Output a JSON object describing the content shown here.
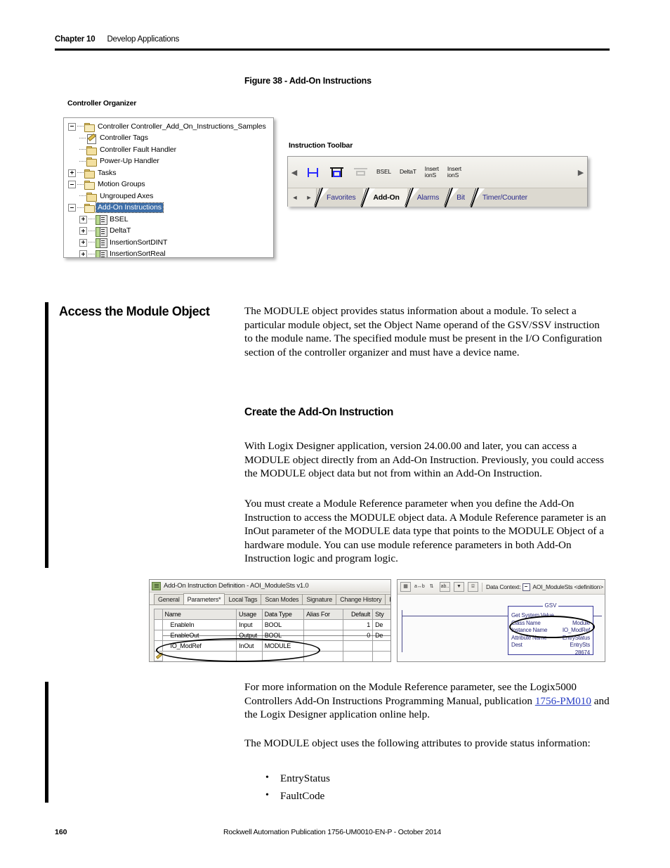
{
  "header": {
    "chapter": "Chapter 10",
    "title": "Develop Applications"
  },
  "figure": {
    "caption": "Figure 38 - Add-On Instructions",
    "organizer_label": "Controller Organizer",
    "toolbar_label": "Instruction Toolbar"
  },
  "controller_organizer": {
    "nodes": [
      {
        "label": "Controller Controller_Add_On_Instructions_Samples",
        "depth": 0,
        "icon": "folder-open-icon",
        "expander": "minus",
        "selected": false
      },
      {
        "label": "Controller Tags",
        "depth": 1,
        "icon": "tags-icon",
        "expander": "none",
        "selected": false
      },
      {
        "label": "Controller Fault Handler",
        "depth": 1,
        "icon": "folder-icon",
        "expander": "none",
        "selected": false
      },
      {
        "label": "Power-Up Handler",
        "depth": 1,
        "icon": "folder-icon",
        "expander": "none",
        "selected": false
      },
      {
        "label": "Tasks",
        "depth": 0,
        "icon": "folder-icon",
        "expander": "plus",
        "selected": false
      },
      {
        "label": "Motion Groups",
        "depth": 0,
        "icon": "folder-open-icon",
        "expander": "minus",
        "selected": false
      },
      {
        "label": "Ungrouped Axes",
        "depth": 1,
        "icon": "folder-icon",
        "expander": "none",
        "selected": false
      },
      {
        "label": "Add-On Instructions",
        "depth": 0,
        "icon": "folder-open-icon",
        "expander": "minus",
        "selected": true
      },
      {
        "label": "BSEL",
        "depth": 1,
        "icon": "aoi-icon",
        "expander": "plus",
        "selected": false
      },
      {
        "label": "DeltaT",
        "depth": 1,
        "icon": "aoi-icon",
        "expander": "plus",
        "selected": false
      },
      {
        "label": "InsertionSortDINT",
        "depth": 1,
        "icon": "aoi-icon",
        "expander": "plus",
        "selected": false
      },
      {
        "label": "InsertionSortReal",
        "depth": 1,
        "icon": "aoi-icon",
        "expander": "plus",
        "selected": false
      }
    ]
  },
  "instruction_toolbar": {
    "scroll_left": "◀",
    "scroll_right": "▶",
    "instruction_labels": [
      "BSEL",
      "DeltaT",
      "Insert\nionS",
      "Insert\nionS"
    ],
    "tab_prev": "◄",
    "tab_next": "►",
    "tabs": [
      {
        "label": "Favorites",
        "active": false
      },
      {
        "label": "Add-On",
        "active": true
      },
      {
        "label": "Alarms",
        "active": false
      },
      {
        "label": "Bit",
        "active": false
      },
      {
        "label": "Timer/Counter",
        "active": false
      }
    ]
  },
  "sections": {
    "module_object_heading": "Access the Module Object",
    "module_object_body": "The MODULE object provides status information about a module. To select a particular module object, set the Object Name operand of the GSV/SSV instruction to the module name. The specified module must be present in the I/O Configuration section of the controller organizer and must have a device name.",
    "create_heading": "Create the Add-On Instruction",
    "create_body_1": "With Logix Designer application, version 24.00.00 and later, you can access a MODULE object directly from an Add-On Instruction. Previously, you could access the MODULE object data but not from within an Add-On Instruction.",
    "create_body_2": "You must create a Module Reference parameter when you define the Add-On Instruction to access the MODULE object data. A Module Reference parameter is an InOut parameter of the MODULE data type that points to the MODULE Object of a hardware module. You can use module reference parameters in both Add-On Instruction logic and program logic.",
    "more_info_before": "For more information on the Module Reference parameter, see the Logix5000 Controllers Add-On Instructions Programming Manual, publication ",
    "more_info_link": "1756-PM010",
    "more_info_after": " and the Logix Designer application online help.",
    "attributes_intro": "The MODULE object uses the following attributes to provide status information:",
    "attributes": [
      "EntryStatus",
      "FaultCode"
    ]
  },
  "aoi_dialog": {
    "title": "Add-On Instruction Definition - AOI_ModuleSts v1.0",
    "tabs": [
      {
        "label": "General",
        "active": false
      },
      {
        "label": "Parameters*",
        "active": true
      },
      {
        "label": "Local Tags",
        "active": false
      },
      {
        "label": "Scan Modes",
        "active": false
      },
      {
        "label": "Signature",
        "active": false
      },
      {
        "label": "Change History",
        "active": false
      },
      {
        "label": "Help",
        "active": false
      }
    ],
    "columns": [
      "Name",
      "Usage",
      "Data Type",
      "Alias For",
      "Default",
      "Sty"
    ],
    "rows": [
      {
        "name": "EnableIn",
        "usage": "Input",
        "type": "BOOL",
        "alias": "",
        "default": "1",
        "style": "De"
      },
      {
        "name": "EnableOut",
        "usage": "Output",
        "type": "BOOL",
        "alias": "",
        "default": "0",
        "style": "De"
      },
      {
        "name": "IO_ModRef",
        "usage": "InOut",
        "type": "MODULE",
        "alias": "",
        "default": "",
        "style": ""
      }
    ]
  },
  "ladder_shot": {
    "data_context_label": "Data Context:",
    "data_context_value": "AOI_ModuleSts <definition>",
    "gsv": {
      "title": "GSV",
      "name": "Get System Value",
      "fields": [
        {
          "label": "Class Name",
          "value": "Module"
        },
        {
          "label": "Instance Name",
          "value": "IO_ModRef"
        },
        {
          "label": "Attribute Name",
          "value": "EntryStatus"
        },
        {
          "label": "Dest",
          "value": "EntrySts"
        }
      ],
      "dest_value": "28674"
    }
  },
  "footer": {
    "page_number": "160",
    "publication": "Rockwell Automation Publication 1756-UM0010-EN-P - October 2014"
  }
}
